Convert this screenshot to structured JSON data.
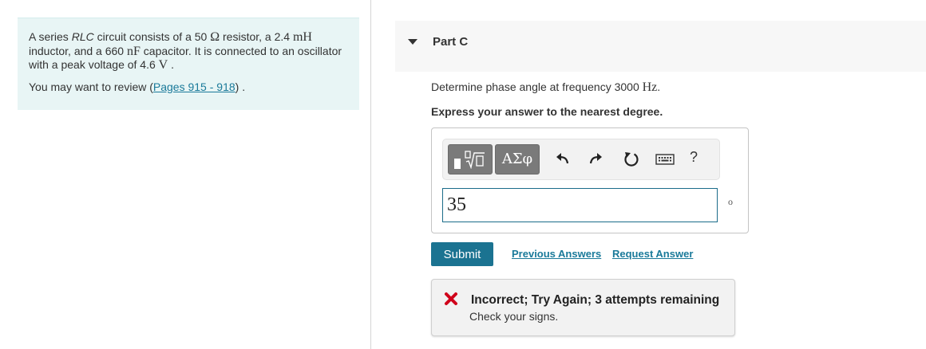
{
  "problem": {
    "p1": "A series ",
    "p2": "RLC",
    "p3": " circuit consists of a 50 ",
    "p4": "Ω",
    "p5": " resistor, a 2.4 ",
    "p6": "mH",
    "p7": " inductor, and a 660 ",
    "p8": "nF",
    "p9": " capacitor. It is connected to an oscillator with a peak voltage of 4.6 ",
    "p10": "V",
    "p11": " .",
    "review_prefix": "You may want to review (",
    "review_link": "Pages 915 - 918",
    "review_suffix": ") ."
  },
  "part": {
    "title": "Part C",
    "question_prefix": "Determine phase angle at frequency 3000 ",
    "question_unit": "Hz",
    "question_suffix": ".",
    "instruction": "Express your answer to the nearest degree."
  },
  "toolbar": {
    "greek_label": "ΑΣφ",
    "help_label": "?"
  },
  "answer": {
    "value": "35",
    "unit": "o"
  },
  "actions": {
    "submit_label": "Submit",
    "previous_answers": "Previous Answers",
    "request_answer": "Request Answer"
  },
  "feedback": {
    "title": "Incorrect; Try Again; 3 attempts remaining",
    "text": "Check your signs."
  },
  "colors": {
    "accent": "#1b7391",
    "left_panel_bg": "#e8f5f5",
    "error": "#d0021b"
  }
}
